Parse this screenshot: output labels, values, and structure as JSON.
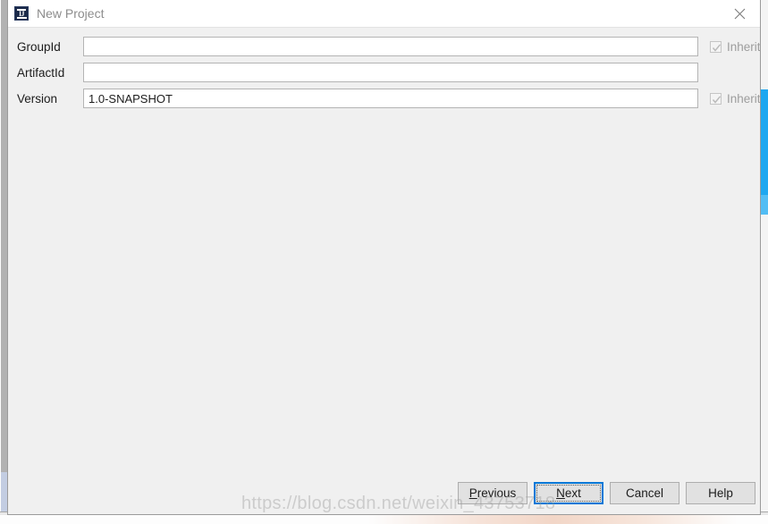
{
  "window": {
    "title": "New Project",
    "app_icon": "intellij-idea-icon",
    "close_icon": "close-icon",
    "accent_color": "#0078d7",
    "titlebar_bg": "#ffffff",
    "dialog_bg": "#f0f0f0"
  },
  "form": {
    "rows": [
      {
        "label": "GroupId",
        "value": "",
        "placeholder": "",
        "inherit": {
          "label": "Inherit",
          "checked": true,
          "enabled": false
        }
      },
      {
        "label": "ArtifactId",
        "value": "",
        "placeholder": "",
        "inherit": null
      },
      {
        "label": "Version",
        "value": "1.0-SNAPSHOT",
        "placeholder": "",
        "inherit": {
          "label": "Inherit",
          "checked": true,
          "enabled": false
        }
      }
    ]
  },
  "buttons": {
    "previous": {
      "label": "Previous",
      "mnemonic": "P",
      "default": false
    },
    "next": {
      "label": "Next",
      "mnemonic": "N",
      "default": true
    },
    "cancel": {
      "label": "Cancel",
      "mnemonic": "",
      "default": false
    },
    "help": {
      "label": "Help",
      "mnemonic": "",
      "default": false
    }
  },
  "watermark": {
    "text": "https://blog.csdn.net/weixin_43753718"
  }
}
